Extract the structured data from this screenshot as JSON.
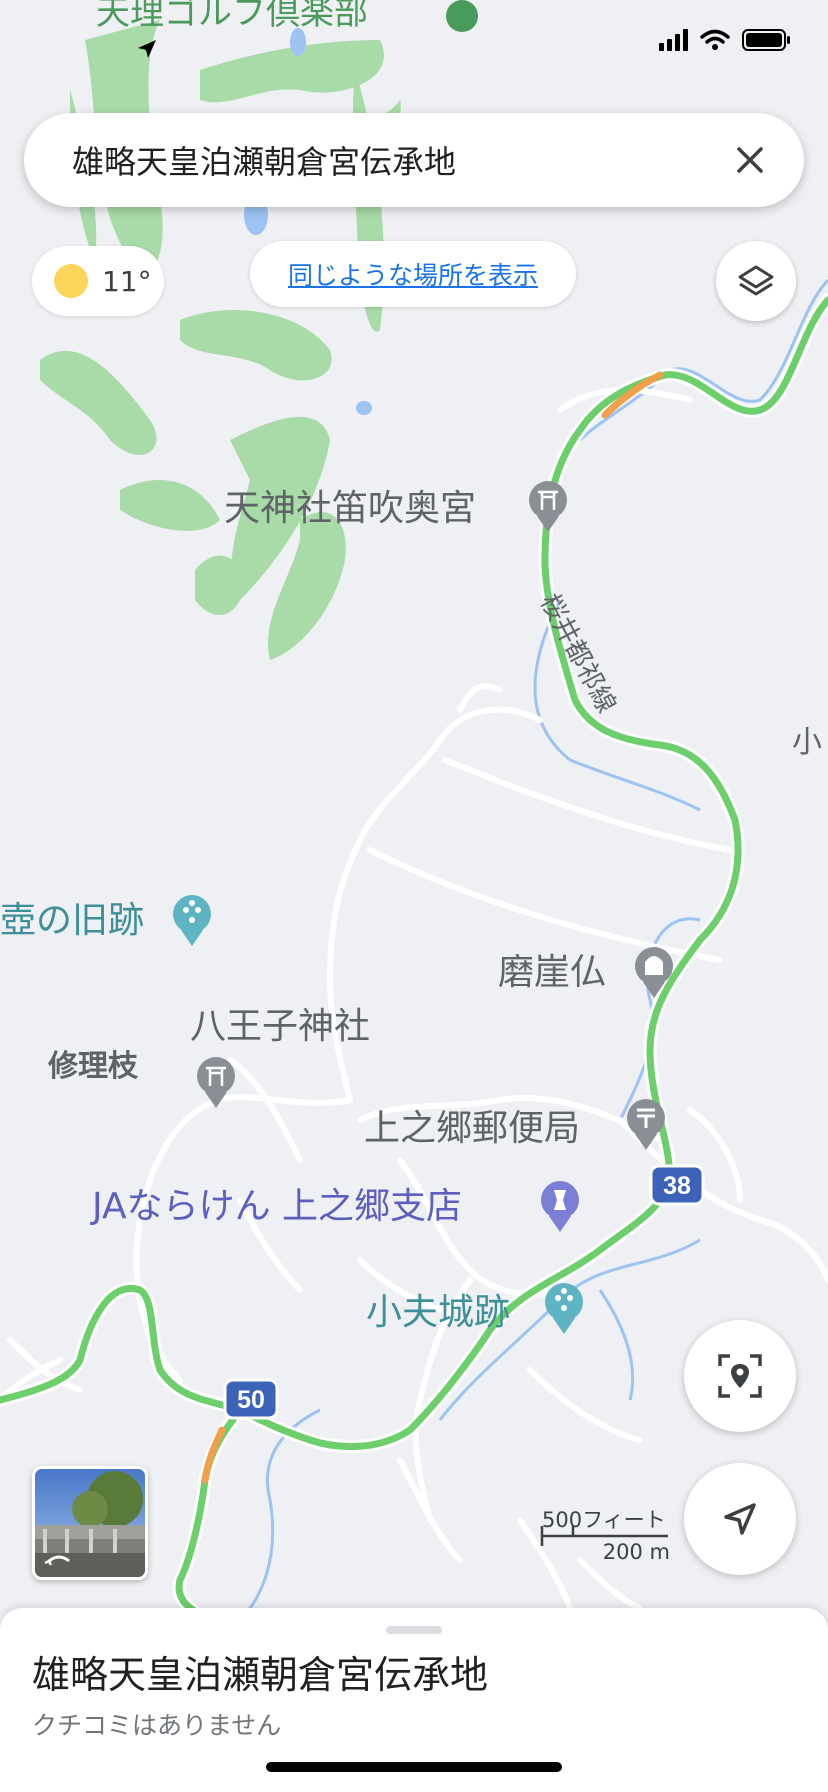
{
  "status_bar": {
    "signal_icon": "cellular-signal-icon",
    "wifi_icon": "wifi-icon",
    "battery_icon": "battery-icon"
  },
  "search": {
    "query": "雄略天皇泊瀬朝倉宮伝承地",
    "clear_icon": "close-icon"
  },
  "weather": {
    "temperature": "11°",
    "icon": "sun-icon"
  },
  "similar_places_label": "同じような場所を表示",
  "layers_icon": "layers-icon",
  "map": {
    "labels": {
      "golf_club": "天理ゴルフ倶楽部",
      "shrine_fuefuki": "天神社笛吹奥宮",
      "road_name": "桜井都祁線",
      "edge_char": "小",
      "old_site": "壺の旧跡",
      "magaibutsu": "磨崖仏",
      "hachioji_shrine": "八王子神社",
      "shurishi": "修理枝",
      "post_office": "上之郷郵便局",
      "ja_bank": "JAならけん 上之郷支店",
      "castle_ruin": "小夫城跡"
    },
    "route_numbers": [
      "38",
      "50"
    ]
  },
  "street_view_icon": "street-view-thumbnail",
  "my_location_icon": "location-pin-scan-icon",
  "navigation_icon": "navigation-arrow-icon",
  "scale": {
    "feet": "500フィート",
    "meters": "200 m"
  },
  "place_sheet": {
    "title": "雄略天皇泊瀬朝倉宮伝承地",
    "reviews_text": "クチコミはありません"
  },
  "colors": {
    "road_green": "#6ccf6c",
    "road_orange": "#f0a04b",
    "route_shield": "#3d63b8",
    "park_green": "#a8dba8",
    "water_blue": "#9cc3f2",
    "accent_blue": "#1a73e8"
  }
}
